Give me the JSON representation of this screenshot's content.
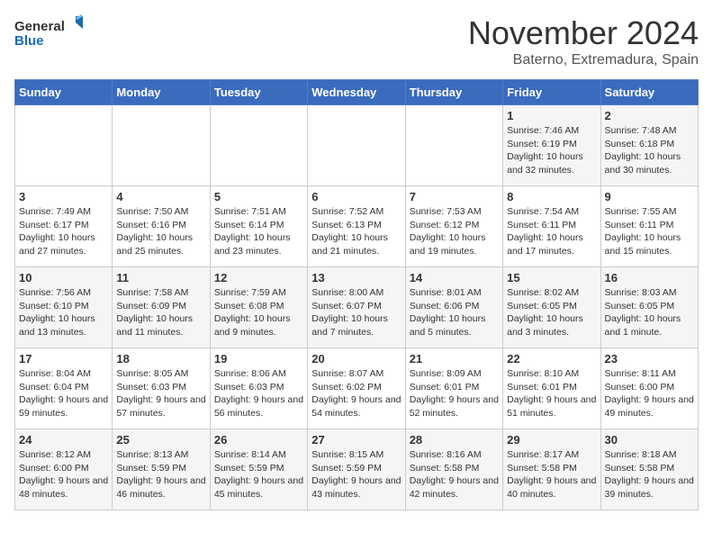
{
  "logo": {
    "line1": "General",
    "line2": "Blue"
  },
  "title": "November 2024",
  "subtitle": "Baterno, Extremadura, Spain",
  "days_of_week": [
    "Sunday",
    "Monday",
    "Tuesday",
    "Wednesday",
    "Thursday",
    "Friday",
    "Saturday"
  ],
  "weeks": [
    [
      {
        "day": "",
        "info": ""
      },
      {
        "day": "",
        "info": ""
      },
      {
        "day": "",
        "info": ""
      },
      {
        "day": "",
        "info": ""
      },
      {
        "day": "",
        "info": ""
      },
      {
        "day": "1",
        "info": "Sunrise: 7:46 AM\nSunset: 6:19 PM\nDaylight: 10 hours and 32 minutes."
      },
      {
        "day": "2",
        "info": "Sunrise: 7:48 AM\nSunset: 6:18 PM\nDaylight: 10 hours and 30 minutes."
      }
    ],
    [
      {
        "day": "3",
        "info": "Sunrise: 7:49 AM\nSunset: 6:17 PM\nDaylight: 10 hours and 27 minutes."
      },
      {
        "day": "4",
        "info": "Sunrise: 7:50 AM\nSunset: 6:16 PM\nDaylight: 10 hours and 25 minutes."
      },
      {
        "day": "5",
        "info": "Sunrise: 7:51 AM\nSunset: 6:14 PM\nDaylight: 10 hours and 23 minutes."
      },
      {
        "day": "6",
        "info": "Sunrise: 7:52 AM\nSunset: 6:13 PM\nDaylight: 10 hours and 21 minutes."
      },
      {
        "day": "7",
        "info": "Sunrise: 7:53 AM\nSunset: 6:12 PM\nDaylight: 10 hours and 19 minutes."
      },
      {
        "day": "8",
        "info": "Sunrise: 7:54 AM\nSunset: 6:11 PM\nDaylight: 10 hours and 17 minutes."
      },
      {
        "day": "9",
        "info": "Sunrise: 7:55 AM\nSunset: 6:11 PM\nDaylight: 10 hours and 15 minutes."
      }
    ],
    [
      {
        "day": "10",
        "info": "Sunrise: 7:56 AM\nSunset: 6:10 PM\nDaylight: 10 hours and 13 minutes."
      },
      {
        "day": "11",
        "info": "Sunrise: 7:58 AM\nSunset: 6:09 PM\nDaylight: 10 hours and 11 minutes."
      },
      {
        "day": "12",
        "info": "Sunrise: 7:59 AM\nSunset: 6:08 PM\nDaylight: 10 hours and 9 minutes."
      },
      {
        "day": "13",
        "info": "Sunrise: 8:00 AM\nSunset: 6:07 PM\nDaylight: 10 hours and 7 minutes."
      },
      {
        "day": "14",
        "info": "Sunrise: 8:01 AM\nSunset: 6:06 PM\nDaylight: 10 hours and 5 minutes."
      },
      {
        "day": "15",
        "info": "Sunrise: 8:02 AM\nSunset: 6:05 PM\nDaylight: 10 hours and 3 minutes."
      },
      {
        "day": "16",
        "info": "Sunrise: 8:03 AM\nSunset: 6:05 PM\nDaylight: 10 hours and 1 minute."
      }
    ],
    [
      {
        "day": "17",
        "info": "Sunrise: 8:04 AM\nSunset: 6:04 PM\nDaylight: 9 hours and 59 minutes."
      },
      {
        "day": "18",
        "info": "Sunrise: 8:05 AM\nSunset: 6:03 PM\nDaylight: 9 hours and 57 minutes."
      },
      {
        "day": "19",
        "info": "Sunrise: 8:06 AM\nSunset: 6:03 PM\nDaylight: 9 hours and 56 minutes."
      },
      {
        "day": "20",
        "info": "Sunrise: 8:07 AM\nSunset: 6:02 PM\nDaylight: 9 hours and 54 minutes."
      },
      {
        "day": "21",
        "info": "Sunrise: 8:09 AM\nSunset: 6:01 PM\nDaylight: 9 hours and 52 minutes."
      },
      {
        "day": "22",
        "info": "Sunrise: 8:10 AM\nSunset: 6:01 PM\nDaylight: 9 hours and 51 minutes."
      },
      {
        "day": "23",
        "info": "Sunrise: 8:11 AM\nSunset: 6:00 PM\nDaylight: 9 hours and 49 minutes."
      }
    ],
    [
      {
        "day": "24",
        "info": "Sunrise: 8:12 AM\nSunset: 6:00 PM\nDaylight: 9 hours and 48 minutes."
      },
      {
        "day": "25",
        "info": "Sunrise: 8:13 AM\nSunset: 5:59 PM\nDaylight: 9 hours and 46 minutes."
      },
      {
        "day": "26",
        "info": "Sunrise: 8:14 AM\nSunset: 5:59 PM\nDaylight: 9 hours and 45 minutes."
      },
      {
        "day": "27",
        "info": "Sunrise: 8:15 AM\nSunset: 5:59 PM\nDaylight: 9 hours and 43 minutes."
      },
      {
        "day": "28",
        "info": "Sunrise: 8:16 AM\nSunset: 5:58 PM\nDaylight: 9 hours and 42 minutes."
      },
      {
        "day": "29",
        "info": "Sunrise: 8:17 AM\nSunset: 5:58 PM\nDaylight: 9 hours and 40 minutes."
      },
      {
        "day": "30",
        "info": "Sunrise: 8:18 AM\nSunset: 5:58 PM\nDaylight: 9 hours and 39 minutes."
      }
    ]
  ]
}
